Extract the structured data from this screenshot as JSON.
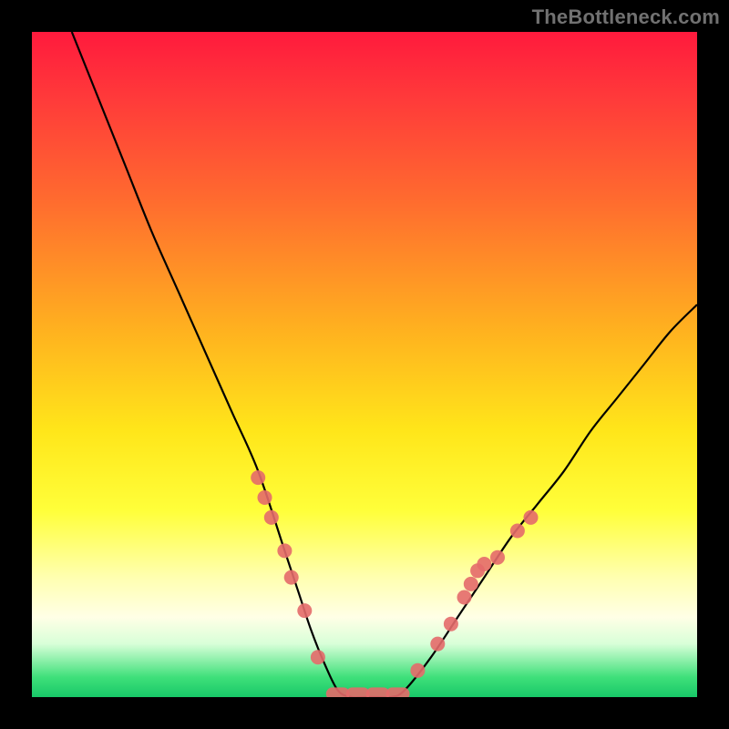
{
  "watermark": {
    "text": "TheBottleneck.com"
  },
  "chart_data": {
    "type": "line",
    "title": "",
    "xlabel": "",
    "ylabel": "",
    "xlim": [
      0,
      100
    ],
    "ylim": [
      0,
      100
    ],
    "grid": false,
    "legend": false,
    "background": "rainbow-gradient-red-to-green",
    "series": [
      {
        "name": "bottleneck-curve",
        "color": "#000000",
        "x": [
          6,
          10,
          14,
          18,
          22,
          26,
          30,
          34,
          38,
          40,
          42,
          44,
          46,
          48,
          50,
          52,
          54,
          56,
          60,
          64,
          68,
          72,
          76,
          80,
          84,
          88,
          92,
          96,
          100
        ],
        "y": [
          100,
          90,
          80,
          70,
          61,
          52,
          43,
          34,
          22,
          16,
          10,
          5,
          1,
          0,
          0,
          0,
          0,
          1,
          6,
          12,
          18,
          24,
          29,
          34,
          40,
          45,
          50,
          55,
          59
        ]
      }
    ],
    "markers": [
      {
        "name": "data-points-left",
        "color": "#e46a6a",
        "shape": "circle",
        "points": [
          {
            "x": 34,
            "y": 33
          },
          {
            "x": 35,
            "y": 30
          },
          {
            "x": 36,
            "y": 27
          },
          {
            "x": 38,
            "y": 22
          },
          {
            "x": 39,
            "y": 18
          },
          {
            "x": 41,
            "y": 13
          },
          {
            "x": 43,
            "y": 6
          }
        ]
      },
      {
        "name": "data-points-bottom",
        "color": "#e46a6a",
        "shape": "rounded-rect",
        "points": [
          {
            "x": 46,
            "y": 0.5
          },
          {
            "x": 49,
            "y": 0.5
          },
          {
            "x": 52,
            "y": 0.5
          },
          {
            "x": 55,
            "y": 0.5
          }
        ]
      },
      {
        "name": "data-points-right",
        "color": "#e46a6a",
        "shape": "circle",
        "points": [
          {
            "x": 58,
            "y": 4
          },
          {
            "x": 61,
            "y": 8
          },
          {
            "x": 63,
            "y": 11
          },
          {
            "x": 65,
            "y": 15
          },
          {
            "x": 66,
            "y": 17
          },
          {
            "x": 67,
            "y": 19
          },
          {
            "x": 68,
            "y": 20
          },
          {
            "x": 70,
            "y": 21
          },
          {
            "x": 73,
            "y": 25
          },
          {
            "x": 75,
            "y": 27
          }
        ]
      }
    ]
  }
}
